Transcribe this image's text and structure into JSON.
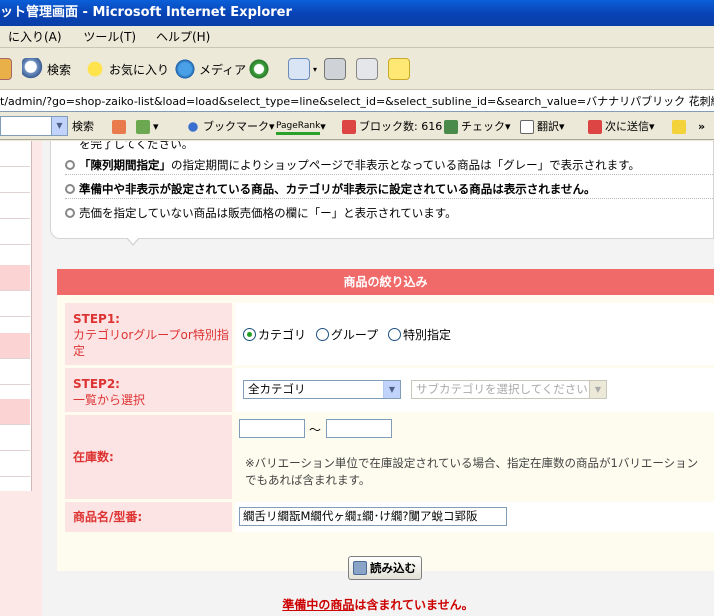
{
  "window": {
    "title": "ット管理画面 - Microsoft Internet Explorer"
  },
  "menu": [
    "に入り(A)",
    "ツール(T)",
    "ヘルプ(H)"
  ],
  "toolbar": {
    "search_label": "検索",
    "favorites_label": "お気に入り",
    "media_label": "メディア"
  },
  "address": {
    "url": "t/admin/?go=shop-zaiko-list&load=load&select_type=line&select_id=&select_subline_id=&search_value=バナナリパブリック 花刺繍コットンワンピース"
  },
  "google_toolbar": {
    "search_label": "検索",
    "bookmark_label": "ブックマーク",
    "pagerank_label": "PageRank",
    "blocked_label": "ブロック数: 616",
    "check_label": "チェック",
    "translate_label": "翻訳",
    "sendto_label": "次に送信",
    "more_label": "»"
  },
  "notes": {
    "partial_line": "を完了してください。",
    "items": [
      {
        "bold": "「陳列期間指定」",
        "rest": "の指定期間によりショップページで非表示となっている商品は「グレー」で表示されます。"
      },
      {
        "bold": "準備中や非表示が設定されている商品、カテゴリが非表示に設定されている商品は表示されません。",
        "rest": ""
      },
      {
        "bold": "",
        "rest": "売価を指定していない商品は販売価格の欄に「ー」と表示されています。"
      }
    ]
  },
  "filter": {
    "heading": "商品の絞り込み",
    "step1": {
      "title": "STEP1:",
      "desc": "カテゴリorグループor特別指定",
      "options": [
        "カテゴリ",
        "グループ",
        "特別指定"
      ],
      "selected": "カテゴリ"
    },
    "step2": {
      "title": "STEP2:",
      "desc": "一覧から選択",
      "category_value": "全カテゴリ",
      "subcategory_placeholder": "サブカテゴリを選択してください"
    },
    "stock": {
      "label": "在庫数:",
      "min": "",
      "max": "",
      "separator": "〜",
      "note": "※バリエーション単位で在庫設定されている場合、指定在庫数の商品が1バリエーションでもあれば含まれます。"
    },
    "product_name": {
      "label": "商品名/型番:",
      "value": "繝舌リ繝翫Μ繝代ヶ繝ｪ繝･け繝?闃ア蛻コ郢阪"
    },
    "load_button": "読み込む"
  },
  "warning": {
    "bold_part": "準備中の商品",
    "rest": "は含まれていません。"
  },
  "colors": {
    "header_red": "#f06a6a",
    "label_pink": "#fde4e4",
    "label_text": "#dd3333",
    "warning": "#cc0000"
  }
}
